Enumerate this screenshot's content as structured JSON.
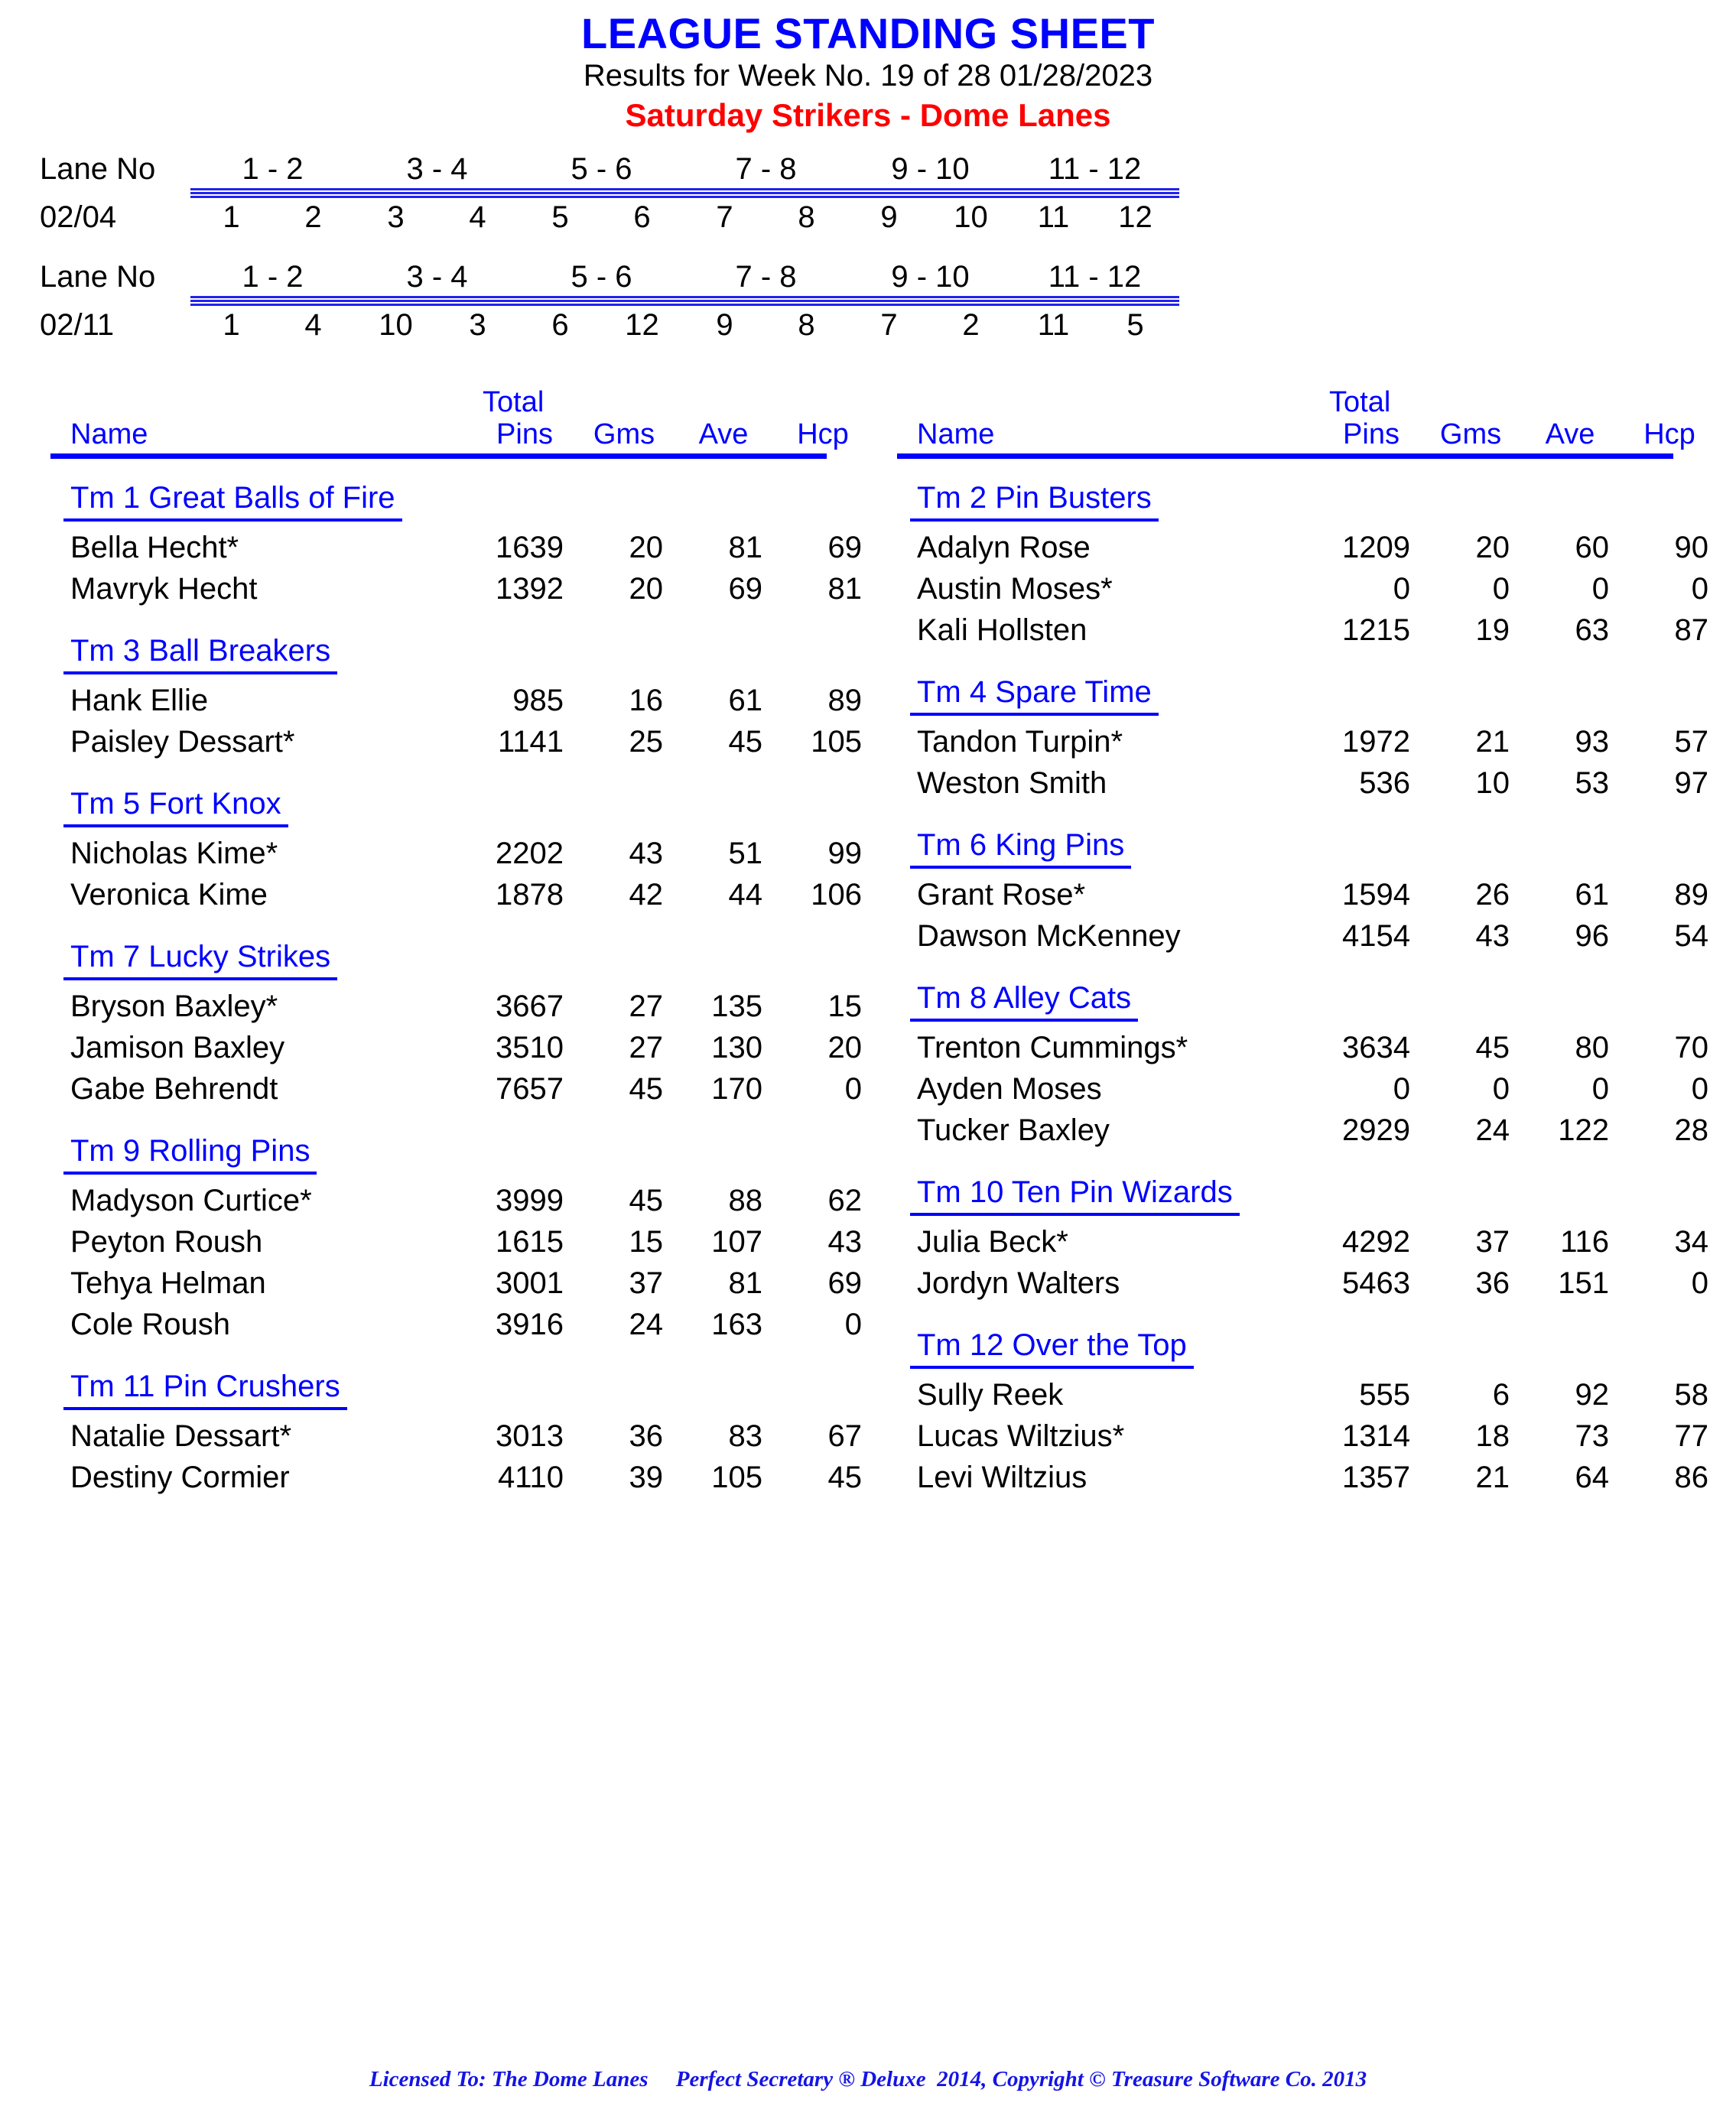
{
  "header": {
    "title": "LEAGUE STANDING SHEET",
    "subtitle": "Results for Week No. 19 of 28    01/28/2023",
    "league": "Saturday Strikers - Dome Lanes",
    "title_color": "#0000ff",
    "league_color": "#ff0000"
  },
  "lane_schedule": [
    {
      "header_label": "Lane No",
      "header_pairs": [
        "1 - 2",
        "3 - 4",
        "5 - 6",
        "7 - 8",
        "9 - 10",
        "11 - 12"
      ],
      "date": "02/04",
      "teams": [
        "1",
        "2",
        "3",
        "4",
        "5",
        "6",
        "7",
        "8",
        "9",
        "10",
        "11",
        "12"
      ]
    },
    {
      "header_label": "Lane No",
      "header_pairs": [
        "1 - 2",
        "3 - 4",
        "5 - 6",
        "7 - 8",
        "9 - 10",
        "11 - 12"
      ],
      "date": "02/11",
      "teams": [
        "1",
        "4",
        "10",
        "3",
        "6",
        "12",
        "9",
        "8",
        "7",
        "2",
        "11",
        "5"
      ]
    }
  ],
  "columns": {
    "headers": {
      "name": "Name",
      "total": "Total",
      "pins": "Pins",
      "gms": "Gms",
      "ave": "Ave",
      "hcp": "Hcp"
    }
  },
  "teams_left": [
    {
      "name": "Tm 1 Great Balls of Fire",
      "players": [
        {
          "name": "Bella Hecht*",
          "pins": "1639",
          "gms": "20",
          "ave": "81",
          "hcp": "69"
        },
        {
          "name": "Mavryk Hecht",
          "pins": "1392",
          "gms": "20",
          "ave": "69",
          "hcp": "81"
        }
      ]
    },
    {
      "name": "Tm 3 Ball Breakers",
      "players": [
        {
          "name": "Hank Ellie",
          "pins": "985",
          "gms": "16",
          "ave": "61",
          "hcp": "89"
        },
        {
          "name": "Paisley Dessart*",
          "pins": "1141",
          "gms": "25",
          "ave": "45",
          "hcp": "105"
        }
      ]
    },
    {
      "name": "Tm 5 Fort Knox",
      "players": [
        {
          "name": "Nicholas Kime*",
          "pins": "2202",
          "gms": "43",
          "ave": "51",
          "hcp": "99"
        },
        {
          "name": "Veronica Kime",
          "pins": "1878",
          "gms": "42",
          "ave": "44",
          "hcp": "106"
        }
      ]
    },
    {
      "name": "Tm 7 Lucky Strikes",
      "players": [
        {
          "name": "Bryson Baxley*",
          "pins": "3667",
          "gms": "27",
          "ave": "135",
          "hcp": "15"
        },
        {
          "name": "Jamison Baxley",
          "pins": "3510",
          "gms": "27",
          "ave": "130",
          "hcp": "20"
        },
        {
          "name": "Gabe Behrendt",
          "pins": "7657",
          "gms": "45",
          "ave": "170",
          "hcp": "0"
        }
      ]
    },
    {
      "name": "Tm 9 Rolling Pins",
      "players": [
        {
          "name": "Madyson Curtice*",
          "pins": "3999",
          "gms": "45",
          "ave": "88",
          "hcp": "62"
        },
        {
          "name": "Peyton Roush",
          "pins": "1615",
          "gms": "15",
          "ave": "107",
          "hcp": "43"
        },
        {
          "name": "Tehya Helman",
          "pins": "3001",
          "gms": "37",
          "ave": "81",
          "hcp": "69"
        },
        {
          "name": "Cole Roush",
          "pins": "3916",
          "gms": "24",
          "ave": "163",
          "hcp": "0"
        }
      ]
    },
    {
      "name": "Tm 11 Pin Crushers",
      "players": [
        {
          "name": "Natalie Dessart*",
          "pins": "3013",
          "gms": "36",
          "ave": "83",
          "hcp": "67"
        },
        {
          "name": "Destiny Cormier",
          "pins": "4110",
          "gms": "39",
          "ave": "105",
          "hcp": "45"
        }
      ]
    }
  ],
  "teams_right": [
    {
      "name": "Tm 2 Pin Busters",
      "players": [
        {
          "name": "Adalyn Rose",
          "pins": "1209",
          "gms": "20",
          "ave": "60",
          "hcp": "90"
        },
        {
          "name": "Austin Moses*",
          "pins": "0",
          "gms": "0",
          "ave": "0",
          "hcp": "0"
        },
        {
          "name": "Kali Hollsten",
          "pins": "1215",
          "gms": "19",
          "ave": "63",
          "hcp": "87"
        }
      ]
    },
    {
      "name": "Tm 4 Spare Time",
      "players": [
        {
          "name": "Tandon Turpin*",
          "pins": "1972",
          "gms": "21",
          "ave": "93",
          "hcp": "57"
        },
        {
          "name": "Weston Smith",
          "pins": "536",
          "gms": "10",
          "ave": "53",
          "hcp": "97"
        }
      ]
    },
    {
      "name": "Tm 6 King Pins",
      "players": [
        {
          "name": "Grant Rose*",
          "pins": "1594",
          "gms": "26",
          "ave": "61",
          "hcp": "89"
        },
        {
          "name": "Dawson McKenney",
          "pins": "4154",
          "gms": "43",
          "ave": "96",
          "hcp": "54"
        }
      ]
    },
    {
      "name": "Tm 8 Alley Cats",
      "players": [
        {
          "name": "Trenton Cummings*",
          "pins": "3634",
          "gms": "45",
          "ave": "80",
          "hcp": "70"
        },
        {
          "name": "Ayden Moses",
          "pins": "0",
          "gms": "0",
          "ave": "0",
          "hcp": "0"
        },
        {
          "name": "Tucker Baxley",
          "pins": "2929",
          "gms": "24",
          "ave": "122",
          "hcp": "28"
        }
      ]
    },
    {
      "name": "Tm 10 Ten Pin Wizards",
      "players": [
        {
          "name": "Julia Beck*",
          "pins": "4292",
          "gms": "37",
          "ave": "116",
          "hcp": "34"
        },
        {
          "name": "Jordyn Walters",
          "pins": "5463",
          "gms": "36",
          "ave": "151",
          "hcp": "0"
        }
      ]
    },
    {
      "name": "Tm 12 Over the Top",
      "players": [
        {
          "name": "Sully Reek",
          "pins": "555",
          "gms": "6",
          "ave": "92",
          "hcp": "58"
        },
        {
          "name": "Lucas Wiltzius*",
          "pins": "1314",
          "gms": "18",
          "ave": "73",
          "hcp": "77"
        },
        {
          "name": "Levi Wiltzius",
          "pins": "1357",
          "gms": "21",
          "ave": "64",
          "hcp": "86"
        }
      ]
    }
  ],
  "footer": {
    "text": "Licensed To: The Dome Lanes     Perfect Secretary ® Deluxe  2014, Copyright © Treasure Software Co. 2013"
  }
}
